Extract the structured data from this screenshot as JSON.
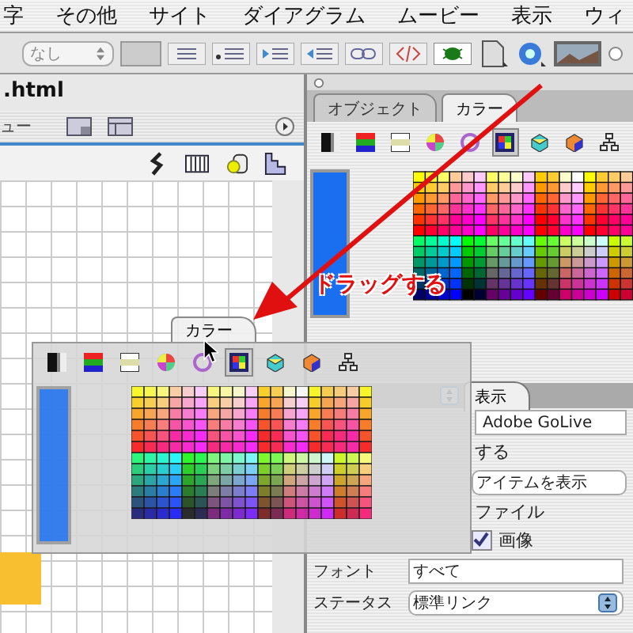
{
  "menu_bar": {
    "items": [
      "字",
      "その他",
      "サイト",
      "ダイアグラム",
      "ムービー",
      "表示",
      "ウィ"
    ]
  },
  "toolbar": {
    "style_select": "なし"
  },
  "document_window": {
    "title": ".html",
    "view_tab": "ュー"
  },
  "color_palette": {
    "tabs": [
      {
        "label": "オブジェクト",
        "selected": false
      },
      {
        "label": "カラー",
        "selected": true
      }
    ],
    "mode_buttons": [
      {
        "kind": "gray",
        "selected": false
      },
      {
        "kind": "rgb",
        "selected": false
      },
      {
        "kind": "cmyk",
        "selected": false
      },
      {
        "kind": "wheel",
        "selected": false
      },
      {
        "kind": "ring",
        "selected": false
      },
      {
        "kind": "palette",
        "selected": true
      },
      {
        "kind": "cube",
        "selected": false
      },
      {
        "kind": "cube2",
        "selected": false
      },
      {
        "kind": "tree",
        "selected": false
      }
    ]
  },
  "inspector": {
    "tab": "表示",
    "rows": [
      {
        "kind": "field",
        "value": "Adobe GoLive"
      },
      {
        "kind": "text",
        "label": "する"
      },
      {
        "kind": "select",
        "value": "アイテムを表示"
      },
      {
        "kind": "text",
        "label": "ファイル"
      },
      {
        "kind": "checkbox",
        "label": "画像",
        "checked": true
      },
      {
        "kind": "labeled",
        "label": "フォント",
        "value": "すべて"
      },
      {
        "kind": "labeled-select",
        "label": "ステータス",
        "value": "標準リンク"
      }
    ]
  },
  "floating_palette": {
    "tab": "カラー",
    "mode_buttons": [
      {
        "kind": "gray",
        "selected": false
      },
      {
        "kind": "rgb",
        "selected": false
      },
      {
        "kind": "cmyk",
        "selected": false
      },
      {
        "kind": "wheel",
        "selected": false
      },
      {
        "kind": "ring",
        "selected": false
      },
      {
        "kind": "palette",
        "selected": true
      },
      {
        "kind": "cube",
        "selected": false
      },
      {
        "kind": "cube2",
        "selected": false
      },
      {
        "kind": "tree",
        "selected": false
      }
    ]
  },
  "annotation": {
    "label": "ドラッグする"
  }
}
